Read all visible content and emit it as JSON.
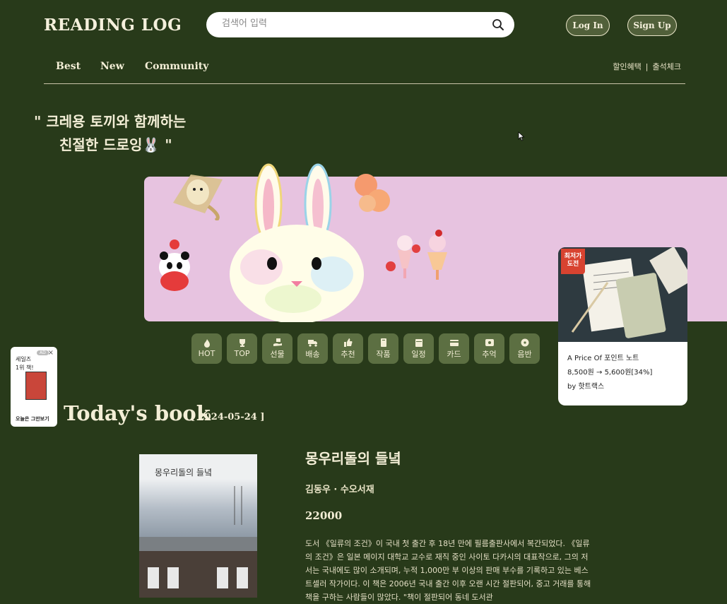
{
  "header": {
    "logo": "READING LOG",
    "search_placeholder": "검색어 입력",
    "login_label": "Log In",
    "signup_label": "Sign Up"
  },
  "nav": {
    "items": [
      "Best",
      "New",
      "Community"
    ],
    "util": [
      "할인혜택",
      "출석체크"
    ],
    "util_separator": "|"
  },
  "hero": {
    "title_line1": "\" 크레용 토끼와 함께하는",
    "title_line2": "친절한 드로잉🐰 \"",
    "banner_color": "#e7c3e0"
  },
  "categories": [
    {
      "label": "HOT",
      "icon": "fire-icon"
    },
    {
      "label": "TOP",
      "icon": "trophy-icon"
    },
    {
      "label": "선물",
      "icon": "gift-hand-icon"
    },
    {
      "label": "배송",
      "icon": "truck-icon"
    },
    {
      "label": "추천",
      "icon": "thumbs-up-icon"
    },
    {
      "label": "작품",
      "icon": "book-icon"
    },
    {
      "label": "일정",
      "icon": "calendar-icon"
    },
    {
      "label": "카드",
      "icon": "card-icon"
    },
    {
      "label": "추억",
      "icon": "photo-box-icon"
    },
    {
      "label": "음반",
      "icon": "disc-icon"
    }
  ],
  "product_card": {
    "badge": "최저가 도전",
    "name": "A Price Of 포인트 노트",
    "price": "8,500원 → 5,600원[34%]",
    "seller": "by 핫트랙스"
  },
  "float_ad": {
    "line1": "세일즈",
    "line2": "1위 책!",
    "badge": "AD",
    "close": "×",
    "footer": "오늘은 그만보기"
  },
  "todays_book": {
    "heading": "Today's book",
    "date": "[ 2024-05-24 ]",
    "title": "몽우리돌의 들녘",
    "author": "김동우 · 수오서재",
    "price": "22000",
    "cover_title": "몽우리돌의 들녘",
    "description": "도서 《일류의 조건》이 국내 첫 출간 후 18년 만에 필름출판사에서 복간되었다. 《일류의 조건》은 일본 메이지 대학교 교수로 재직 중인 사이토 다카시의 대표작으로, 그의 저서는 국내에도 많이 소개되며, 누적 1,000만 부 이상의 판매 부수를 기록하고 있는 베스트셀러 작가이다. 이 책은 2006년 국내 출간 이후 오랜 시간 절판되어, 중고 거래를 통해 책을 구하는 사람들이 많았다. \"책이 절판되어 동네 도서관"
  },
  "colors": {
    "background": "#283a1a",
    "pill_button": "#51603a",
    "category_tile": "#5c6f42",
    "badge_red": "#d84330"
  }
}
